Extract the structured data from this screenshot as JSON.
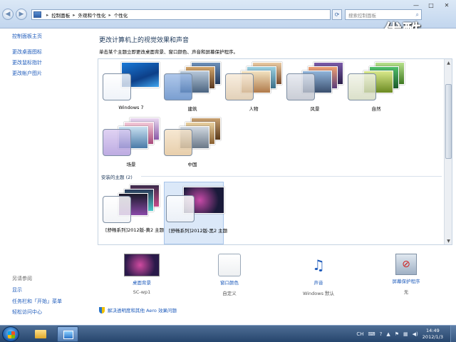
{
  "address_bar": {
    "crumbs": [
      "控制面板",
      "外观和个性化",
      "个性化"
    ],
    "search_placeholder": "搜索控制面板"
  },
  "window_controls": {
    "minimize": "—",
    "maximize": "□",
    "close": "✕"
  },
  "watermark": "优酷",
  "sidebar": {
    "home": "控制面板主页",
    "links": [
      "更改桌面图标",
      "更改鼠标指针",
      "更改帐户图片"
    ],
    "see_also_title": "另请参阅",
    "see_also": [
      "显示",
      "任务栏和「开始」菜单",
      "轻松访问中心"
    ]
  },
  "main": {
    "title": "更改计算机上的视觉效果和声音",
    "subtitle": "单击某个主题立即更改桌面背景、窗口颜色、声音和屏幕保护程序。",
    "themes": [
      {
        "name": "Windows 7"
      },
      {
        "name": "建筑"
      },
      {
        "name": "人物"
      },
      {
        "name": "风景"
      },
      {
        "name": "自然"
      },
      {
        "name": "场景"
      },
      {
        "name": "中国"
      }
    ],
    "installed_section": "安装的主题 (2)",
    "installed_themes": [
      {
        "name": "[舒畅系列]2012版-黄2 主题"
      },
      {
        "name": "[舒畅系列]2012版-黑2 主题"
      }
    ]
  },
  "bottom": {
    "background": {
      "name": "桌面背景",
      "value": "SC-wp1"
    },
    "color": {
      "name": "窗口颜色",
      "value": "自定义"
    },
    "sound": {
      "name": "声音",
      "value": "Windows 默认"
    },
    "screensaver": {
      "name": "屏幕保护程序",
      "value": "无"
    },
    "aero_link": "解决透明度和其他 Aero 效果问题"
  },
  "taskbar": {
    "tray_lang": "CH",
    "time": "14:49",
    "date": "2012/1/3"
  },
  "colors": {
    "accent": "#1e5bbb",
    "title": "#1e395b",
    "taskbar": "#26456d"
  }
}
